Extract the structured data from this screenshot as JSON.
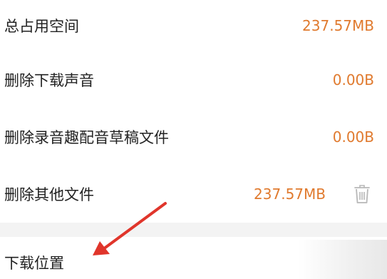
{
  "storage": {
    "rows": [
      {
        "label": "总占用空间",
        "value": "237.57MB"
      },
      {
        "label": "删除下载声音",
        "value": "0.00B"
      },
      {
        "label": "删除录音趣配音草稿文件",
        "value": "0.00B"
      },
      {
        "label": "删除其他文件",
        "value": "237.57MB"
      }
    ],
    "download_location": {
      "label": "下载位置"
    }
  },
  "colors": {
    "accent": "#e07a2e",
    "arrow": "#e0352b",
    "text": "#222222",
    "divider": "#f3f3f3"
  },
  "icons": {
    "delete": "trash-icon"
  }
}
